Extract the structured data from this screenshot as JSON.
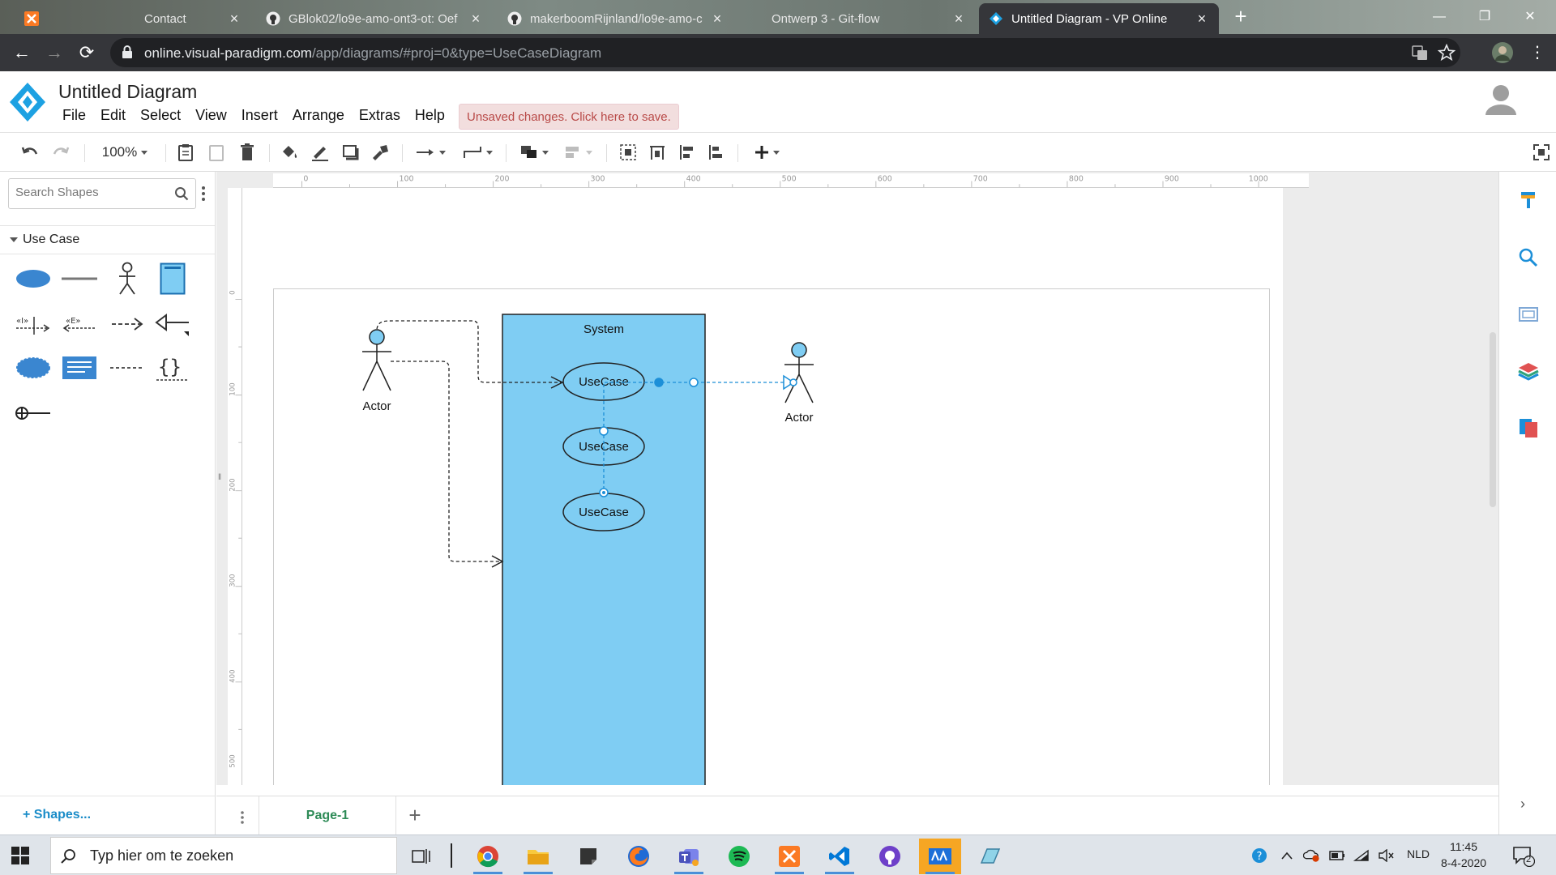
{
  "browser": {
    "tabs": [
      {
        "title": "Contact",
        "icon": "xampp-icon",
        "active": false
      },
      {
        "title": "GBlok02/lo9e-amo-ont3-ot: Oef",
        "icon": "github-icon",
        "active": false
      },
      {
        "title": "makerboomRijnland/lo9e-amo-c",
        "icon": "github-icon",
        "active": false
      },
      {
        "title": "Ontwerp 3 - Git-flow",
        "icon": "tab-icon",
        "active": false
      },
      {
        "title": "Untitled Diagram - VP Online",
        "icon": "vp-icon",
        "active": true
      }
    ],
    "url": {
      "host": "online.visual-paradigm.com",
      "path": "/app/diagrams/#proj=0&type=UseCaseDiagram"
    }
  },
  "app": {
    "title": "Untitled Diagram",
    "menu": [
      "File",
      "Edit",
      "Select",
      "View",
      "Insert",
      "Arrange",
      "Extras",
      "Help"
    ],
    "unsaved_notice": "Unsaved changes. Click here to save.",
    "zoom": "100%"
  },
  "left_panel": {
    "search_placeholder": "Search Shapes",
    "section": "Use Case",
    "shapes_link": "+ Shapes..."
  },
  "rulers": {
    "top": [
      "0",
      "100",
      "200",
      "300",
      "400",
      "500",
      "600",
      "700",
      "800",
      "900",
      "1000",
      "1100"
    ],
    "left": [
      "0",
      "100",
      "200",
      "300",
      "400",
      "500"
    ]
  },
  "diagram": {
    "system_label": "System",
    "actor_left": "Actor",
    "actor_right": "Actor",
    "usecases": [
      "UseCase",
      "UseCase",
      "UseCase"
    ],
    "colors": {
      "system_fill": "#7fcdf3",
      "actor_head": "#7fcdf3",
      "selection": "#1c8fd8"
    }
  },
  "pages": {
    "tabs": [
      "Page-1"
    ]
  },
  "taskbar": {
    "search_text": "Typ hier om te zoeken",
    "language": "NLD",
    "time": "11:45",
    "date": "8-4-2020",
    "notification_count": "2"
  }
}
